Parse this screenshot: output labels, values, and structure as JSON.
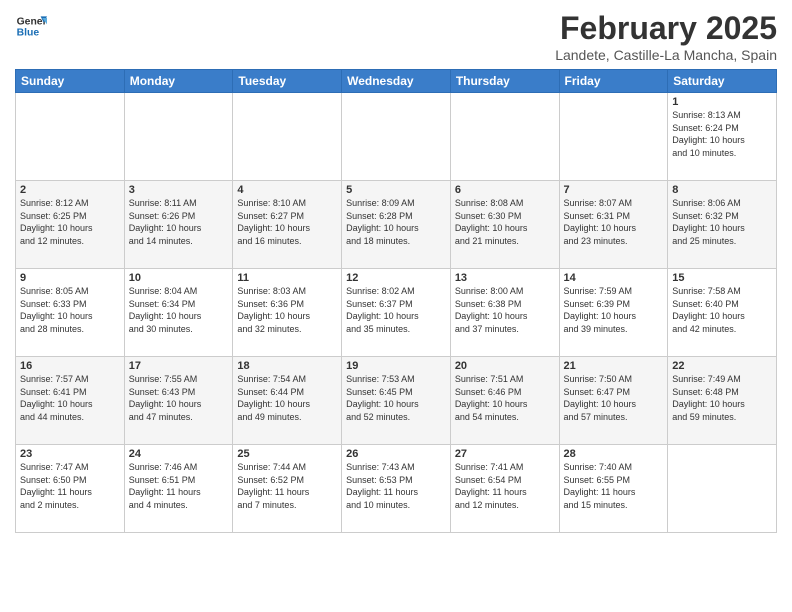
{
  "logo": {
    "line1": "General",
    "line2": "Blue"
  },
  "title": "February 2025",
  "subtitle": "Landete, Castille-La Mancha, Spain",
  "days_of_week": [
    "Sunday",
    "Monday",
    "Tuesday",
    "Wednesday",
    "Thursday",
    "Friday",
    "Saturday"
  ],
  "weeks": [
    [
      {
        "day": "",
        "info": ""
      },
      {
        "day": "",
        "info": ""
      },
      {
        "day": "",
        "info": ""
      },
      {
        "day": "",
        "info": ""
      },
      {
        "day": "",
        "info": ""
      },
      {
        "day": "",
        "info": ""
      },
      {
        "day": "1",
        "info": "Sunrise: 8:13 AM\nSunset: 6:24 PM\nDaylight: 10 hours\nand 10 minutes."
      }
    ],
    [
      {
        "day": "2",
        "info": "Sunrise: 8:12 AM\nSunset: 6:25 PM\nDaylight: 10 hours\nand 12 minutes."
      },
      {
        "day": "3",
        "info": "Sunrise: 8:11 AM\nSunset: 6:26 PM\nDaylight: 10 hours\nand 14 minutes."
      },
      {
        "day": "4",
        "info": "Sunrise: 8:10 AM\nSunset: 6:27 PM\nDaylight: 10 hours\nand 16 minutes."
      },
      {
        "day": "5",
        "info": "Sunrise: 8:09 AM\nSunset: 6:28 PM\nDaylight: 10 hours\nand 18 minutes."
      },
      {
        "day": "6",
        "info": "Sunrise: 8:08 AM\nSunset: 6:30 PM\nDaylight: 10 hours\nand 21 minutes."
      },
      {
        "day": "7",
        "info": "Sunrise: 8:07 AM\nSunset: 6:31 PM\nDaylight: 10 hours\nand 23 minutes."
      },
      {
        "day": "8",
        "info": "Sunrise: 8:06 AM\nSunset: 6:32 PM\nDaylight: 10 hours\nand 25 minutes."
      }
    ],
    [
      {
        "day": "9",
        "info": "Sunrise: 8:05 AM\nSunset: 6:33 PM\nDaylight: 10 hours\nand 28 minutes."
      },
      {
        "day": "10",
        "info": "Sunrise: 8:04 AM\nSunset: 6:34 PM\nDaylight: 10 hours\nand 30 minutes."
      },
      {
        "day": "11",
        "info": "Sunrise: 8:03 AM\nSunset: 6:36 PM\nDaylight: 10 hours\nand 32 minutes."
      },
      {
        "day": "12",
        "info": "Sunrise: 8:02 AM\nSunset: 6:37 PM\nDaylight: 10 hours\nand 35 minutes."
      },
      {
        "day": "13",
        "info": "Sunrise: 8:00 AM\nSunset: 6:38 PM\nDaylight: 10 hours\nand 37 minutes."
      },
      {
        "day": "14",
        "info": "Sunrise: 7:59 AM\nSunset: 6:39 PM\nDaylight: 10 hours\nand 39 minutes."
      },
      {
        "day": "15",
        "info": "Sunrise: 7:58 AM\nSunset: 6:40 PM\nDaylight: 10 hours\nand 42 minutes."
      }
    ],
    [
      {
        "day": "16",
        "info": "Sunrise: 7:57 AM\nSunset: 6:41 PM\nDaylight: 10 hours\nand 44 minutes."
      },
      {
        "day": "17",
        "info": "Sunrise: 7:55 AM\nSunset: 6:43 PM\nDaylight: 10 hours\nand 47 minutes."
      },
      {
        "day": "18",
        "info": "Sunrise: 7:54 AM\nSunset: 6:44 PM\nDaylight: 10 hours\nand 49 minutes."
      },
      {
        "day": "19",
        "info": "Sunrise: 7:53 AM\nSunset: 6:45 PM\nDaylight: 10 hours\nand 52 minutes."
      },
      {
        "day": "20",
        "info": "Sunrise: 7:51 AM\nSunset: 6:46 PM\nDaylight: 10 hours\nand 54 minutes."
      },
      {
        "day": "21",
        "info": "Sunrise: 7:50 AM\nSunset: 6:47 PM\nDaylight: 10 hours\nand 57 minutes."
      },
      {
        "day": "22",
        "info": "Sunrise: 7:49 AM\nSunset: 6:48 PM\nDaylight: 10 hours\nand 59 minutes."
      }
    ],
    [
      {
        "day": "23",
        "info": "Sunrise: 7:47 AM\nSunset: 6:50 PM\nDaylight: 11 hours\nand 2 minutes."
      },
      {
        "day": "24",
        "info": "Sunrise: 7:46 AM\nSunset: 6:51 PM\nDaylight: 11 hours\nand 4 minutes."
      },
      {
        "day": "25",
        "info": "Sunrise: 7:44 AM\nSunset: 6:52 PM\nDaylight: 11 hours\nand 7 minutes."
      },
      {
        "day": "26",
        "info": "Sunrise: 7:43 AM\nSunset: 6:53 PM\nDaylight: 11 hours\nand 10 minutes."
      },
      {
        "day": "27",
        "info": "Sunrise: 7:41 AM\nSunset: 6:54 PM\nDaylight: 11 hours\nand 12 minutes."
      },
      {
        "day": "28",
        "info": "Sunrise: 7:40 AM\nSunset: 6:55 PM\nDaylight: 11 hours\nand 15 minutes."
      },
      {
        "day": "",
        "info": ""
      }
    ]
  ]
}
